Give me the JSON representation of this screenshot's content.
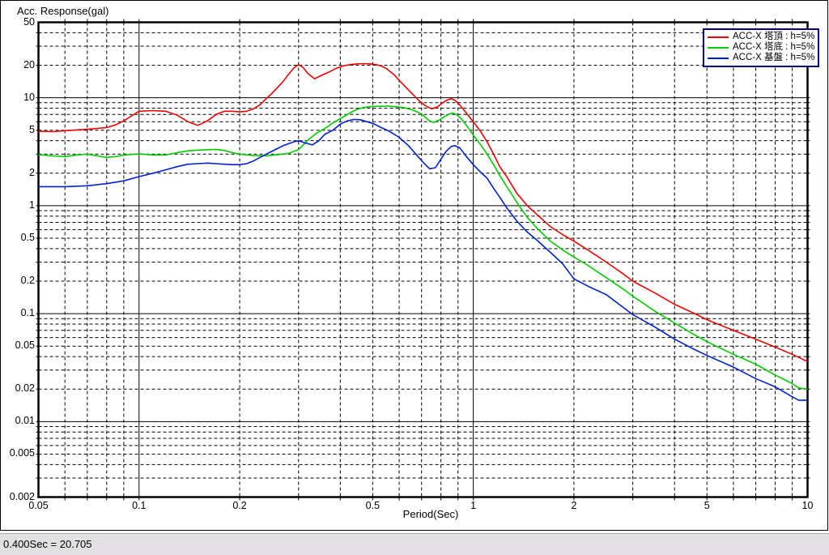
{
  "statusbar": {
    "text": "0.400Sec = 20.705"
  },
  "chart_data": {
    "type": "line",
    "y_axis_title": "Acc. Response(gal)",
    "xlabel": "Period(Sec)",
    "x_scale": "log",
    "y_scale": "log",
    "xlim": [
      0.05,
      10
    ],
    "ylim": [
      0.002,
      50
    ],
    "grid": {
      "major_style": "solid",
      "minor_style": "dashed",
      "color": "#000000"
    },
    "x_ticks": [
      {
        "value": 0.05,
        "label": "0.05"
      },
      {
        "value": 0.1,
        "label": "0.1"
      },
      {
        "value": 0.2,
        "label": "0.2"
      },
      {
        "value": 0.5,
        "label": "0.5"
      },
      {
        "value": 1,
        "label": "1"
      },
      {
        "value": 2,
        "label": "2"
      },
      {
        "value": 5,
        "label": "5"
      },
      {
        "value": 10,
        "label": "10"
      }
    ],
    "y_ticks": [
      {
        "value": 50,
        "label": "50"
      },
      {
        "value": 20,
        "label": "20"
      },
      {
        "value": 10,
        "label": "10"
      },
      {
        "value": 5,
        "label": "5"
      },
      {
        "value": 2,
        "label": "2"
      },
      {
        "value": 1,
        "label": "1"
      },
      {
        "value": 0.5,
        "label": "0.5"
      },
      {
        "value": 0.2,
        "label": "0.2"
      },
      {
        "value": 0.1,
        "label": "0.1"
      },
      {
        "value": 0.05,
        "label": "0.05"
      },
      {
        "value": 0.02,
        "label": "0.02"
      },
      {
        "value": 0.01,
        "label": "0.01"
      },
      {
        "value": 0.005,
        "label": "0.005"
      },
      {
        "value": 0.002,
        "label": "0.002"
      }
    ],
    "legend": {
      "position": "top-right",
      "border_color": "#000080"
    },
    "series": [
      {
        "name": "ACC-X 塔頂 : h=5%",
        "color": "#ee0000",
        "points": [
          [
            0.05,
            4.9
          ],
          [
            0.055,
            4.85
          ],
          [
            0.06,
            4.95
          ],
          [
            0.07,
            5.1
          ],
          [
            0.08,
            5.3
          ],
          [
            0.085,
            5.6
          ],
          [
            0.09,
            6.1
          ],
          [
            0.095,
            6.8
          ],
          [
            0.1,
            7.5
          ],
          [
            0.11,
            7.6
          ],
          [
            0.12,
            7.5
          ],
          [
            0.13,
            6.9
          ],
          [
            0.14,
            6.0
          ],
          [
            0.15,
            5.55
          ],
          [
            0.16,
            6.1
          ],
          [
            0.17,
            7.0
          ],
          [
            0.18,
            7.5
          ],
          [
            0.19,
            7.5
          ],
          [
            0.2,
            7.4
          ],
          [
            0.21,
            7.5
          ],
          [
            0.22,
            7.9
          ],
          [
            0.23,
            8.6
          ],
          [
            0.24,
            9.8
          ],
          [
            0.25,
            11.0
          ],
          [
            0.26,
            12.5
          ],
          [
            0.27,
            14.2
          ],
          [
            0.28,
            16.5
          ],
          [
            0.29,
            18.8
          ],
          [
            0.3,
            20.3
          ],
          [
            0.31,
            19.0
          ],
          [
            0.32,
            16.8
          ],
          [
            0.335,
            15.0
          ],
          [
            0.35,
            16.0
          ],
          [
            0.37,
            17.3
          ],
          [
            0.39,
            18.8
          ],
          [
            0.41,
            19.8
          ],
          [
            0.43,
            20.3
          ],
          [
            0.45,
            20.6
          ],
          [
            0.47,
            20.7
          ],
          [
            0.49,
            20.6
          ],
          [
            0.51,
            20.3
          ],
          [
            0.53,
            19.7
          ],
          [
            0.55,
            18.6
          ],
          [
            0.58,
            16.3
          ],
          [
            0.6,
            14.5
          ],
          [
            0.63,
            12.4
          ],
          [
            0.66,
            10.7
          ],
          [
            0.69,
            9.3
          ],
          [
            0.72,
            8.4
          ],
          [
            0.75,
            7.9
          ],
          [
            0.78,
            8.2
          ],
          [
            0.81,
            9.0
          ],
          [
            0.84,
            9.6
          ],
          [
            0.86,
            9.8
          ],
          [
            0.88,
            9.5
          ],
          [
            0.91,
            8.6
          ],
          [
            0.95,
            7.3
          ],
          [
            1.0,
            6.0
          ],
          [
            1.05,
            4.9
          ],
          [
            1.1,
            3.9
          ],
          [
            1.15,
            3.0
          ],
          [
            1.2,
            2.3
          ],
          [
            1.26,
            1.85
          ],
          [
            1.35,
            1.3
          ],
          [
            1.45,
            1.0
          ],
          [
            1.55,
            0.83
          ],
          [
            1.7,
            0.64
          ],
          [
            1.85,
            0.54
          ],
          [
            2.0,
            0.47
          ],
          [
            2.2,
            0.39
          ],
          [
            2.5,
            0.3
          ],
          [
            2.8,
            0.235
          ],
          [
            3.0,
            0.2
          ],
          [
            3.5,
            0.155
          ],
          [
            4.0,
            0.122
          ],
          [
            4.6,
            0.1
          ],
          [
            5.0,
            0.088
          ],
          [
            6.0,
            0.07
          ],
          [
            7.0,
            0.058
          ],
          [
            8.0,
            0.049
          ],
          [
            9.0,
            0.042
          ],
          [
            10.0,
            0.036
          ]
        ]
      },
      {
        "name": "ACC-X 塔底 : h=5%",
        "color": "#00cc00",
        "points": [
          [
            0.05,
            2.97
          ],
          [
            0.055,
            2.9
          ],
          [
            0.06,
            2.85
          ],
          [
            0.065,
            2.95
          ],
          [
            0.07,
            3.0
          ],
          [
            0.075,
            2.9
          ],
          [
            0.08,
            2.8
          ],
          [
            0.085,
            2.85
          ],
          [
            0.09,
            2.95
          ],
          [
            0.1,
            3.02
          ],
          [
            0.11,
            2.95
          ],
          [
            0.12,
            2.95
          ],
          [
            0.13,
            3.1
          ],
          [
            0.14,
            3.22
          ],
          [
            0.15,
            3.27
          ],
          [
            0.16,
            3.3
          ],
          [
            0.17,
            3.32
          ],
          [
            0.18,
            3.25
          ],
          [
            0.19,
            3.1
          ],
          [
            0.2,
            3.0
          ],
          [
            0.22,
            2.92
          ],
          [
            0.24,
            2.9
          ],
          [
            0.26,
            2.97
          ],
          [
            0.28,
            3.05
          ],
          [
            0.3,
            3.3
          ],
          [
            0.32,
            4.05
          ],
          [
            0.34,
            4.7
          ],
          [
            0.36,
            5.2
          ],
          [
            0.38,
            5.85
          ],
          [
            0.4,
            6.4
          ],
          [
            0.42,
            7.0
          ],
          [
            0.44,
            7.6
          ],
          [
            0.46,
            8.0
          ],
          [
            0.48,
            8.2
          ],
          [
            0.5,
            8.3
          ],
          [
            0.53,
            8.35
          ],
          [
            0.56,
            8.35
          ],
          [
            0.59,
            8.25
          ],
          [
            0.62,
            8.1
          ],
          [
            0.65,
            7.8
          ],
          [
            0.68,
            7.4
          ],
          [
            0.71,
            6.8
          ],
          [
            0.74,
            6.1
          ],
          [
            0.76,
            5.9
          ],
          [
            0.79,
            6.2
          ],
          [
            0.82,
            6.7
          ],
          [
            0.85,
            7.1
          ],
          [
            0.87,
            7.2
          ],
          [
            0.89,
            7.0
          ],
          [
            0.92,
            6.4
          ],
          [
            0.96,
            5.4
          ],
          [
            1.0,
            4.5
          ],
          [
            1.05,
            3.7
          ],
          [
            1.1,
            3.0
          ],
          [
            1.15,
            2.4
          ],
          [
            1.2,
            1.9
          ],
          [
            1.26,
            1.5
          ],
          [
            1.35,
            1.07
          ],
          [
            1.45,
            0.78
          ],
          [
            1.55,
            0.62
          ],
          [
            1.7,
            0.47
          ],
          [
            1.85,
            0.39
          ],
          [
            2.0,
            0.335
          ],
          [
            2.2,
            0.28
          ],
          [
            2.5,
            0.215
          ],
          [
            2.8,
            0.17
          ],
          [
            3.0,
            0.145
          ],
          [
            3.5,
            0.105
          ],
          [
            4.0,
            0.082
          ],
          [
            4.5,
            0.066
          ],
          [
            5.0,
            0.055
          ],
          [
            6.0,
            0.042
          ],
          [
            7.0,
            0.034
          ],
          [
            8.0,
            0.027
          ],
          [
            9.0,
            0.0225
          ],
          [
            9.4,
            0.0205
          ],
          [
            10.0,
            0.02
          ]
        ]
      },
      {
        "name": "ACC-X 基盤 : h=5%",
        "color": "#0022cc",
        "points": [
          [
            0.05,
            1.5
          ],
          [
            0.06,
            1.5
          ],
          [
            0.07,
            1.53
          ],
          [
            0.08,
            1.6
          ],
          [
            0.09,
            1.7
          ],
          [
            0.1,
            1.86
          ],
          [
            0.11,
            2.0
          ],
          [
            0.12,
            2.15
          ],
          [
            0.13,
            2.3
          ],
          [
            0.14,
            2.42
          ],
          [
            0.15,
            2.45
          ],
          [
            0.16,
            2.48
          ],
          [
            0.17,
            2.45
          ],
          [
            0.18,
            2.42
          ],
          [
            0.19,
            2.4
          ],
          [
            0.2,
            2.4
          ],
          [
            0.21,
            2.45
          ],
          [
            0.22,
            2.6
          ],
          [
            0.23,
            2.8
          ],
          [
            0.24,
            3.0
          ],
          [
            0.25,
            3.2
          ],
          [
            0.26,
            3.4
          ],
          [
            0.27,
            3.6
          ],
          [
            0.28,
            3.75
          ],
          [
            0.29,
            3.9
          ],
          [
            0.3,
            4.0
          ],
          [
            0.315,
            3.8
          ],
          [
            0.33,
            3.66
          ],
          [
            0.345,
            4.0
          ],
          [
            0.36,
            4.6
          ],
          [
            0.38,
            5.0
          ],
          [
            0.4,
            5.7
          ],
          [
            0.42,
            6.1
          ],
          [
            0.44,
            6.3
          ],
          [
            0.46,
            6.25
          ],
          [
            0.48,
            6.0
          ],
          [
            0.5,
            5.8
          ],
          [
            0.53,
            5.3
          ],
          [
            0.56,
            4.9
          ],
          [
            0.6,
            4.3
          ],
          [
            0.64,
            3.6
          ],
          [
            0.68,
            2.9
          ],
          [
            0.71,
            2.5
          ],
          [
            0.74,
            2.2
          ],
          [
            0.77,
            2.25
          ],
          [
            0.8,
            2.7
          ],
          [
            0.83,
            3.2
          ],
          [
            0.86,
            3.55
          ],
          [
            0.88,
            3.6
          ],
          [
            0.91,
            3.45
          ],
          [
            0.95,
            2.9
          ],
          [
            1.0,
            2.4
          ],
          [
            1.05,
            2.05
          ],
          [
            1.1,
            1.8
          ],
          [
            1.15,
            1.45
          ],
          [
            1.2,
            1.2
          ],
          [
            1.26,
            0.95
          ],
          [
            1.35,
            0.72
          ],
          [
            1.45,
            0.57
          ],
          [
            1.55,
            0.48
          ],
          [
            1.7,
            0.37
          ],
          [
            1.85,
            0.29
          ],
          [
            2.0,
            0.21
          ],
          [
            2.2,
            0.18
          ],
          [
            2.5,
            0.15
          ],
          [
            2.8,
            0.115
          ],
          [
            3.0,
            0.098
          ],
          [
            3.5,
            0.075
          ],
          [
            4.0,
            0.058
          ],
          [
            4.5,
            0.048
          ],
          [
            5.0,
            0.041
          ],
          [
            6.0,
            0.032
          ],
          [
            7.0,
            0.025
          ],
          [
            8.0,
            0.021
          ],
          [
            9.0,
            0.017
          ],
          [
            9.4,
            0.0158
          ],
          [
            10.0,
            0.0158
          ]
        ]
      }
    ]
  }
}
